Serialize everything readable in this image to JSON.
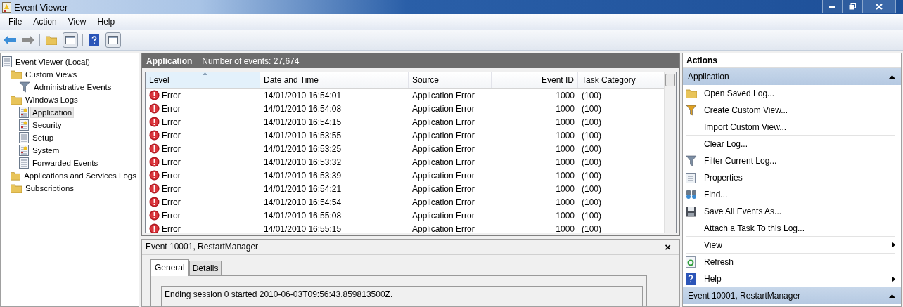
{
  "window": {
    "title": "Event Viewer"
  },
  "menu": [
    "File",
    "Action",
    "View",
    "Help"
  ],
  "tree": [
    {
      "label": "Event Viewer (Local)",
      "selected": false,
      "children": [
        {
          "label": "Custom Views",
          "selected": false,
          "children": [
            {
              "label": "Administrative Events",
              "selected": false
            }
          ]
        },
        {
          "label": "Windows Logs",
          "selected": false,
          "children": [
            {
              "label": "Application",
              "selected": true
            },
            {
              "label": "Security",
              "selected": false
            },
            {
              "label": "Setup",
              "selected": false
            },
            {
              "label": "System",
              "selected": false
            },
            {
              "label": "Forwarded Events",
              "selected": false
            }
          ]
        },
        {
          "label": "Applications and Services Logs",
          "selected": false
        },
        {
          "label": "Subscriptions",
          "selected": false
        }
      ]
    }
  ],
  "log_header": {
    "title": "Application",
    "count": "Number of events: 27,674"
  },
  "table": {
    "columns": [
      {
        "label": "Level",
        "sorted": true
      },
      {
        "label": "Date and Time",
        "sorted": false
      },
      {
        "label": "Source",
        "sorted": false
      },
      {
        "label": "Event ID",
        "sorted": false
      },
      {
        "label": "Task Category",
        "sorted": false
      }
    ],
    "rows": [
      [
        "Error",
        "14/01/2010 16:54:01",
        "Application Error",
        "1000",
        "(100)"
      ],
      [
        "Error",
        "14/01/2010 16:54:08",
        "Application Error",
        "1000",
        "(100)"
      ],
      [
        "Error",
        "14/01/2010 16:54:15",
        "Application Error",
        "1000",
        "(100)"
      ],
      [
        "Error",
        "14/01/2010 16:53:55",
        "Application Error",
        "1000",
        "(100)"
      ],
      [
        "Error",
        "14/01/2010 16:53:25",
        "Application Error",
        "1000",
        "(100)"
      ],
      [
        "Error",
        "14/01/2010 16:53:32",
        "Application Error",
        "1000",
        "(100)"
      ],
      [
        "Error",
        "14/01/2010 16:53:39",
        "Application Error",
        "1000",
        "(100)"
      ],
      [
        "Error",
        "14/01/2010 16:54:21",
        "Application Error",
        "1000",
        "(100)"
      ],
      [
        "Error",
        "14/01/2010 16:54:54",
        "Application Error",
        "1000",
        "(100)"
      ],
      [
        "Error",
        "14/01/2010 16:55:08",
        "Application Error",
        "1000",
        "(100)"
      ],
      [
        "Error",
        "14/01/2010 16:55:15",
        "Application Error",
        "1000",
        "(100)"
      ]
    ]
  },
  "detail": {
    "title": "Event 10001, RestartManager",
    "close": "×",
    "tabs": [
      {
        "label": "General",
        "selected": true
      },
      {
        "label": "Details",
        "selected": false
      }
    ],
    "message": "Ending session 0 started 2010-06-03T09:56:43.859813500Z."
  },
  "actions": {
    "title": "Actions",
    "sections": [
      {
        "title": "Application",
        "expanded": true,
        "items": [
          {
            "label": "Open Saved Log...",
            "kind": "action",
            "divider": false
          },
          {
            "label": "Create Custom View...",
            "kind": "action",
            "divider": false
          },
          {
            "label": "Import Custom View...",
            "kind": "action",
            "divider": true
          },
          {
            "label": "Clear Log...",
            "kind": "action",
            "divider": false
          },
          {
            "label": "Filter Current Log...",
            "kind": "action",
            "divider": false
          },
          {
            "label": "Properties",
            "kind": "action",
            "divider": false
          },
          {
            "label": "Find...",
            "kind": "action",
            "divider": false
          },
          {
            "label": "Save All Events As...",
            "kind": "action",
            "divider": false
          },
          {
            "label": "Attach a Task To this Log...",
            "kind": "action",
            "divider": true
          },
          {
            "label": "View",
            "kind": "submenu",
            "divider": true
          },
          {
            "label": "Refresh",
            "kind": "action",
            "divider": true
          },
          {
            "label": "Help",
            "kind": "submenu",
            "divider": false
          }
        ]
      },
      {
        "title": "Event 10001, RestartManager",
        "expanded": true
      }
    ]
  }
}
